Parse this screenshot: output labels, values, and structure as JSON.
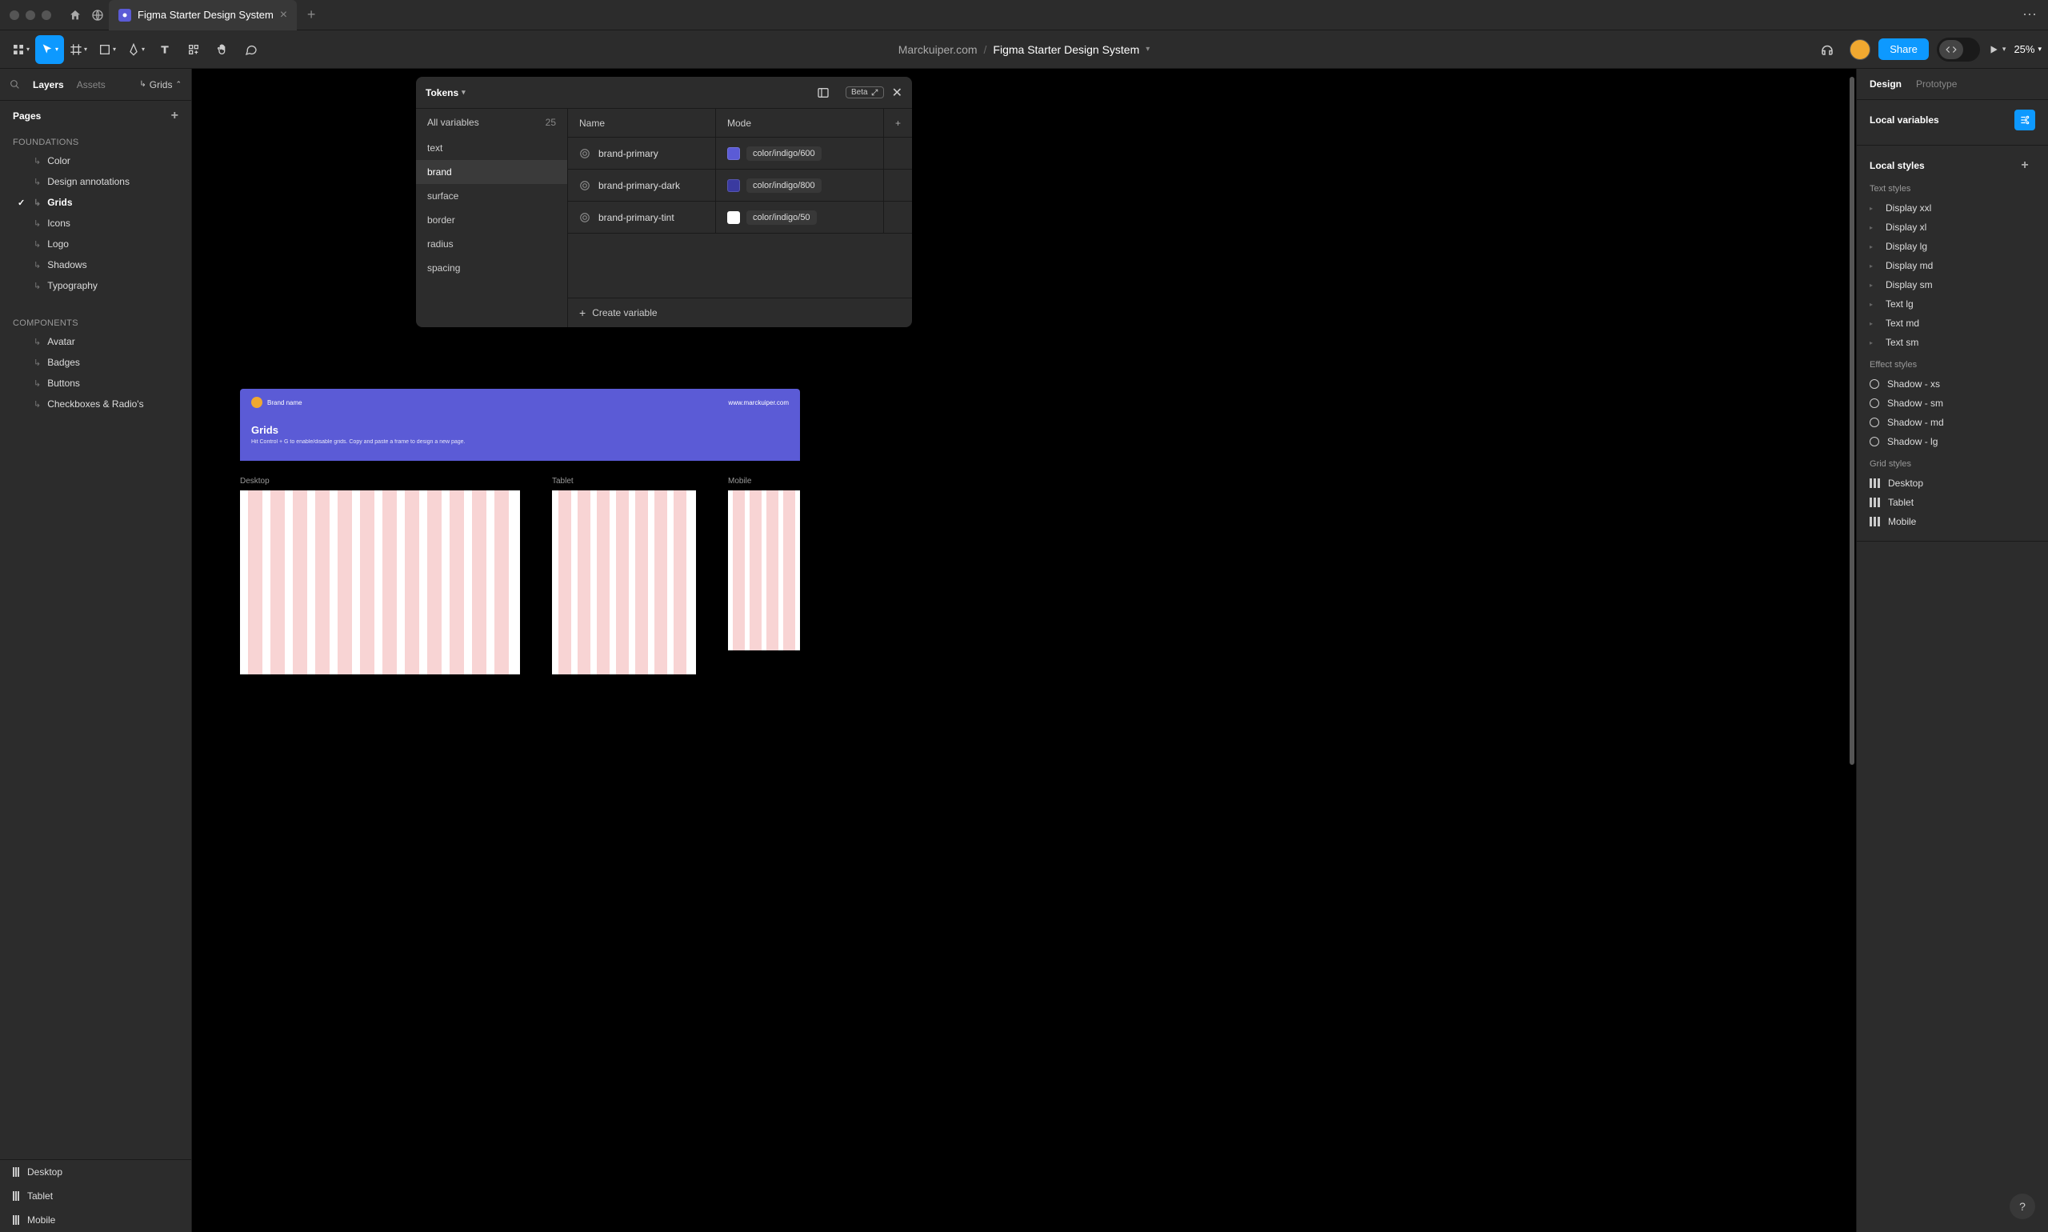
{
  "window": {
    "tab_title": "Figma Starter Design System"
  },
  "toolbar": {
    "breadcrumb_team": "Marckuiper.com",
    "breadcrumb_file": "Figma Starter Design System",
    "share_label": "Share",
    "zoom": "25%"
  },
  "left": {
    "tab_layers": "Layers",
    "tab_assets": "Assets",
    "crumb": "Grids",
    "pages_title": "Pages",
    "groups": [
      {
        "title": "FOUNDATIONS",
        "items": [
          {
            "label": "Color",
            "selected": false
          },
          {
            "label": "Design annotations",
            "selected": false
          },
          {
            "label": "Grids",
            "selected": true
          },
          {
            "label": "Icons",
            "selected": false
          },
          {
            "label": "Logo",
            "selected": false
          },
          {
            "label": "Shadows",
            "selected": false
          },
          {
            "label": "Typography",
            "selected": false
          }
        ]
      },
      {
        "title": "COMPONENTS",
        "items": [
          {
            "label": "Avatar",
            "selected": false
          },
          {
            "label": "Badges",
            "selected": false
          },
          {
            "label": "Buttons",
            "selected": false
          },
          {
            "label": "Checkboxes & Radio's",
            "selected": false
          }
        ]
      }
    ],
    "layers": [
      {
        "label": "Desktop"
      },
      {
        "label": "Tablet"
      },
      {
        "label": "Mobile"
      }
    ]
  },
  "vars": {
    "title": "Tokens",
    "beta": "Beta",
    "all_label": "All variables",
    "all_count": "25",
    "categories": [
      {
        "label": "text",
        "active": false
      },
      {
        "label": "brand",
        "active": true
      },
      {
        "label": "surface",
        "active": false
      },
      {
        "label": "border",
        "active": false
      },
      {
        "label": "radius",
        "active": false
      },
      {
        "label": "spacing",
        "active": false
      }
    ],
    "col_name": "Name",
    "col_mode": "Mode",
    "rows": [
      {
        "name": "brand-primary",
        "alias": "color/indigo/600",
        "swatch": "#5b5bd6"
      },
      {
        "name": "brand-primary-dark",
        "alias": "color/indigo/800",
        "swatch": "#3a3aa0"
      },
      {
        "name": "brand-primary-tint",
        "alias": "color/indigo/50",
        "swatch": "#ffffff"
      }
    ],
    "create_label": "Create variable"
  },
  "canvas": {
    "brand_name": "Brand name",
    "brand_url": "www.marckuiper.com",
    "section_title": "Grids",
    "section_desc": "Hit Control + G to enable/disable grids. Copy and paste a frame to design a new page.",
    "frames": [
      {
        "label": "Desktop"
      },
      {
        "label": "Tablet"
      },
      {
        "label": "Mobile"
      }
    ]
  },
  "right": {
    "tab_design": "Design",
    "tab_prototype": "Prototype",
    "local_vars": "Local variables",
    "local_styles": "Local styles",
    "text_styles_head": "Text styles",
    "text_styles": [
      "Display xxl",
      "Display xl",
      "Display lg",
      "Display md",
      "Display sm",
      "Text lg",
      "Text md",
      "Text sm"
    ],
    "effect_styles_head": "Effect styles",
    "effect_styles": [
      "Shadow - xs",
      "Shadow - sm",
      "Shadow - md",
      "Shadow - lg"
    ],
    "grid_styles_head": "Grid styles",
    "grid_styles": [
      "Desktop",
      "Tablet",
      "Mobile"
    ]
  }
}
